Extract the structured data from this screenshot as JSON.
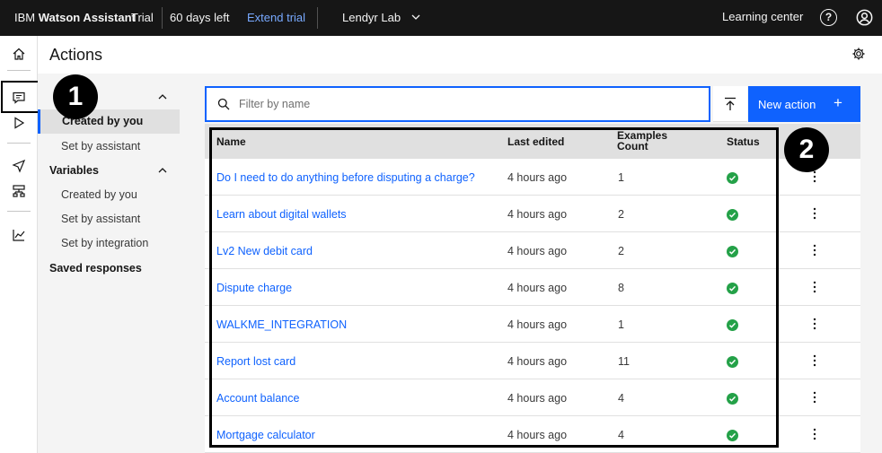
{
  "topbar": {
    "brand_prefix": "IBM",
    "brand_name": "Watson Assistant",
    "trial": "Trial",
    "days_left": "60 days left",
    "extend": "Extend trial",
    "instance": "Lendyr Lab",
    "learning": "Learning center",
    "help_glyph": "?"
  },
  "page": {
    "title": "Actions"
  },
  "nav": {
    "created_by_you": "Created by you",
    "set_by_assistant": "Set by assistant",
    "variables": "Variables",
    "var_created_by_you": "Created by you",
    "var_set_by_assistant": "Set by assistant",
    "var_set_by_integration": "Set by integration",
    "saved_responses": "Saved responses"
  },
  "search": {
    "placeholder": "Filter by name"
  },
  "new_action": {
    "label": "New action",
    "plus": "+"
  },
  "table": {
    "headers": {
      "name": "Name",
      "last_edited": "Last edited",
      "examples_1": "Examples",
      "examples_2": "Count",
      "status": "Status"
    },
    "rows": [
      {
        "name": "Do I need to do anything before disputing a charge?",
        "edited": "4 hours ago",
        "count": "1"
      },
      {
        "name": "Learn about digital wallets",
        "edited": "4 hours ago",
        "count": "2"
      },
      {
        "name": "Lv2 New debit card",
        "edited": "4 hours ago",
        "count": "2"
      },
      {
        "name": "Dispute charge",
        "edited": "4 hours ago",
        "count": "8"
      },
      {
        "name": "WALKME_INTEGRATION",
        "edited": "4 hours ago",
        "count": "1"
      },
      {
        "name": "Report lost card",
        "edited": "4 hours ago",
        "count": "11"
      },
      {
        "name": "Account balance",
        "edited": "4 hours ago",
        "count": "4"
      },
      {
        "name": "Mortgage calculator",
        "edited": "4 hours ago",
        "count": "4"
      }
    ]
  },
  "annotations": {
    "badge1": "1",
    "badge2": "2"
  },
  "colors": {
    "accent": "#0f62fe",
    "success": "#24a148",
    "topbar": "#161616"
  },
  "icons": [
    "home-icon",
    "actions-icon",
    "preview-icon",
    "publish-icon",
    "environments-icon",
    "analytics-icon",
    "settings-icon",
    "search-icon",
    "upload-icon",
    "overflow-menu-icon",
    "checkmark-icon",
    "help-icon",
    "user-icon",
    "chevron-down-icon",
    "chevron-up-icon"
  ]
}
